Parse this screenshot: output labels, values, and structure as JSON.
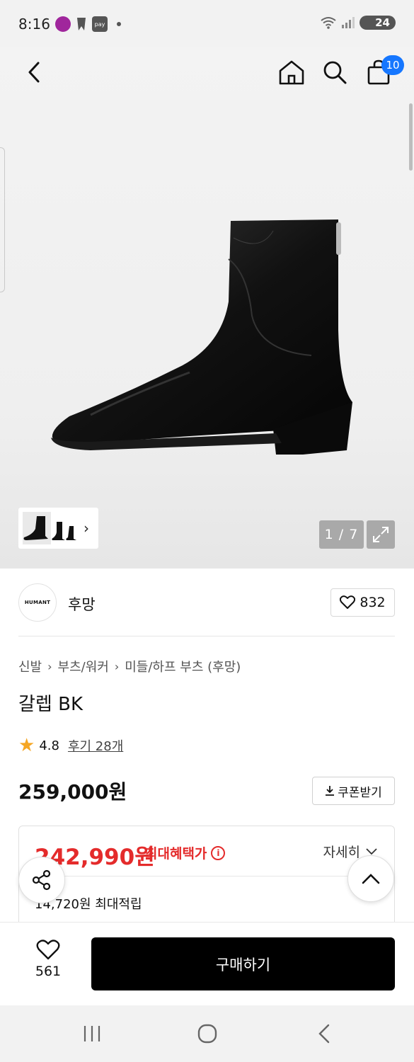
{
  "status_bar": {
    "time": "8:16",
    "notif_1": "Super good",
    "notif_3": "pay",
    "battery": "24"
  },
  "header": {
    "cart_count": "10",
    "icons": [
      "back-icon",
      "home-icon",
      "search-icon",
      "bag-icon"
    ]
  },
  "gallery": {
    "page_indicator": "1 / 7"
  },
  "brand": {
    "logo_text": "HUMANT",
    "name": "후망",
    "like_count": "832"
  },
  "breadcrumb": [
    "신발",
    "부츠/워커",
    "미들/하프 부츠 (후망)"
  ],
  "product": {
    "title": "갈렙 BK",
    "rating": "4.8",
    "review_link": "후기 28개",
    "price": "259,000원",
    "coupon_label": "쿠폰받기"
  },
  "benefit": {
    "sale_price": "242,990원",
    "label": "최대혜택가",
    "detail_link": "자세히",
    "points": "14,720원 최대적립"
  },
  "bottom_bar": {
    "wish_count": "561",
    "buy_label": "구매하기"
  },
  "colors": {
    "accent_red": "#e42b2b",
    "badge_blue": "#1677ff",
    "star": "#f5a623"
  }
}
